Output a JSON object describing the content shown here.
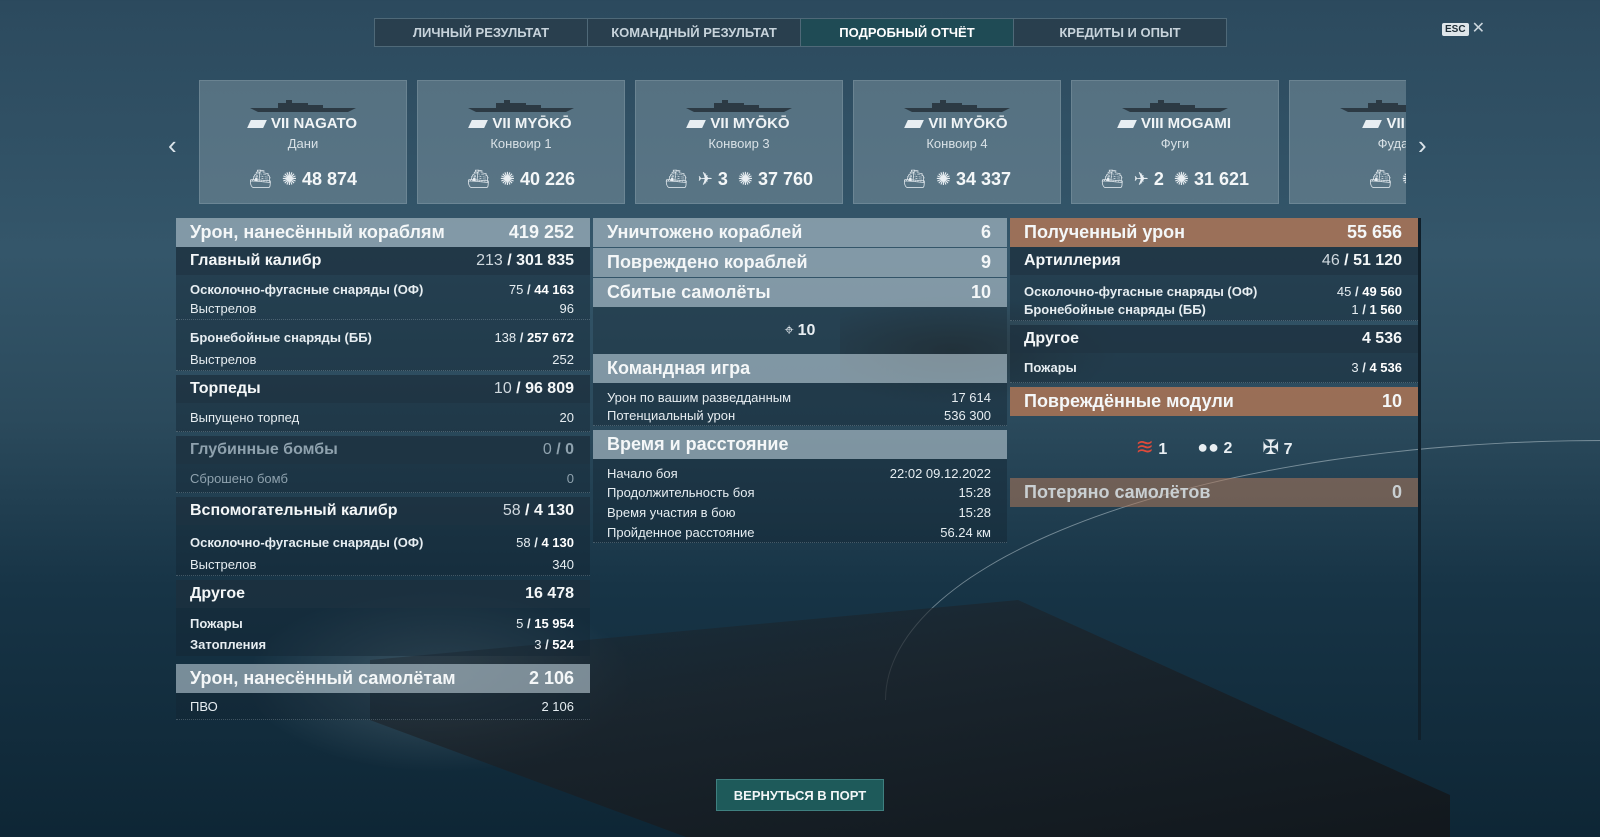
{
  "tabs": [
    "ЛИЧНЫЙ РЕЗУЛЬТАТ",
    "КОМАНДНЫЙ РЕЗУЛЬТАТ",
    "ПОДРОБНЫЙ ОТЧЁТ",
    "КРЕДИТЫ И ОПЫТ"
  ],
  "active_tab": 2,
  "esc_label": "ESC",
  "close_glyph": "✕",
  "arrows": {
    "left": "‹",
    "right": "›"
  },
  "ships": [
    {
      "name": "VII NAGATO",
      "player": "Дани",
      "planes": "",
      "damage": "48 874"
    },
    {
      "name": "VII MYŌKŌ",
      "player": "Конвоир 1",
      "planes": "",
      "damage": "40 226"
    },
    {
      "name": "VII MYŌKŌ",
      "player": "Конвоир 3",
      "planes": "3",
      "damage": "37 760"
    },
    {
      "name": "VII MYŌKŌ",
      "player": "Конвоир 4",
      "planes": "",
      "damage": "34 337"
    },
    {
      "name": "VIII MOGAMI",
      "player": "Фуги",
      "planes": "2",
      "damage": "31 621"
    },
    {
      "name": "VII M",
      "player": "Фуда",
      "planes": "",
      "damage": ""
    }
  ],
  "left": {
    "ship_damage": {
      "label": "Урон, нанесённый кораблям",
      "value": "419 252"
    },
    "main_battery": {
      "label": "Главный калибр",
      "hits": "213",
      "value": "301 835"
    },
    "mb_he": {
      "label": "Осколочно-фугасные снаряды (ОФ)",
      "hits": "75",
      "value": "44 163"
    },
    "mb_he_shots": {
      "label": "Выстрелов",
      "value": "96"
    },
    "mb_ap": {
      "label": "Бронебойные снаряды (ББ)",
      "hits": "138",
      "value": "257 672"
    },
    "mb_ap_shots": {
      "label": "Выстрелов",
      "value": "252"
    },
    "torpedoes": {
      "label": "Торпеды",
      "hits": "10",
      "value": "96 809"
    },
    "torp_launched": {
      "label": "Выпущено торпед",
      "value": "20"
    },
    "depth_charges": {
      "label": "Глубинные бомбы",
      "hits": "0",
      "value": "0"
    },
    "dc_dropped": {
      "label": "Сброшено бомб",
      "value": "0"
    },
    "secondary": {
      "label": "Вспомогательный калибр",
      "hits": "58",
      "value": "4 130"
    },
    "sec_he": {
      "label": "Осколочно-фугасные снаряды (ОФ)",
      "hits": "58",
      "value": "4 130"
    },
    "sec_shots": {
      "label": "Выстрелов",
      "value": "340"
    },
    "other": {
      "label": "Другое",
      "value": "16 478"
    },
    "fires": {
      "label": "Пожары",
      "hits": "5",
      "value": "15 954"
    },
    "floods": {
      "label": "Затопления",
      "hits": "3",
      "value": "524"
    },
    "plane_damage": {
      "label": "Урон, нанесённый самолётам",
      "value": "2 106"
    },
    "aa": {
      "label": "ПВО",
      "value": "2 106"
    }
  },
  "middle": {
    "destroyed": {
      "label": "Уничтожено кораблей",
      "value": "6"
    },
    "damaged": {
      "label": "Повреждено кораблей",
      "value": "9"
    },
    "planes_shot": {
      "label": "Сбитые самолёты",
      "value": "10"
    },
    "aa_icon_count": "10",
    "teamplay": {
      "label": "Командная игра"
    },
    "spotting": {
      "label": "Урон по вашим разведданным",
      "value": "17 614"
    },
    "potential": {
      "label": "Потенциальный урон",
      "value": "536 300"
    },
    "time": {
      "label": "Время и расстояние"
    },
    "start": {
      "label": "Начало боя",
      "value": "22:02  09.12.2022"
    },
    "duration": {
      "label": "Продолжительность боя",
      "value": "15:28"
    },
    "participation": {
      "label": "Время участия в бою",
      "value": "15:28"
    },
    "distance": {
      "label": "Пройденное расстояние",
      "value": "56.24 км"
    }
  },
  "right": {
    "received": {
      "label": "Полученный урон",
      "value": "55 656"
    },
    "artillery": {
      "label": "Артиллерия",
      "hits": "46",
      "value": "51 120"
    },
    "r_he": {
      "label": "Осколочно-фугасные снаряды (ОФ)",
      "hits": "45",
      "value": "49 560"
    },
    "r_ap": {
      "label": "Бронебойные снаряды (ББ)",
      "hits": "1",
      "value": "1 560"
    },
    "r_other": {
      "label": "Другое",
      "value": "4 536"
    },
    "r_fires": {
      "label": "Пожары",
      "hits": "3",
      "value": "4 536"
    },
    "modules": {
      "label": "Повреждённые модули",
      "value": "10"
    },
    "module_counts": [
      "1",
      "2",
      "7"
    ],
    "lost_planes": {
      "label": "Потеряно самолётов",
      "value": "0"
    }
  },
  "port_button": "ВЕРНУТЬСЯ В ПОРТ",
  "colors": {
    "accent_orange": "#b9784e",
    "active_tab": "#1f4b55",
    "port_button": "#1e5a5a"
  }
}
